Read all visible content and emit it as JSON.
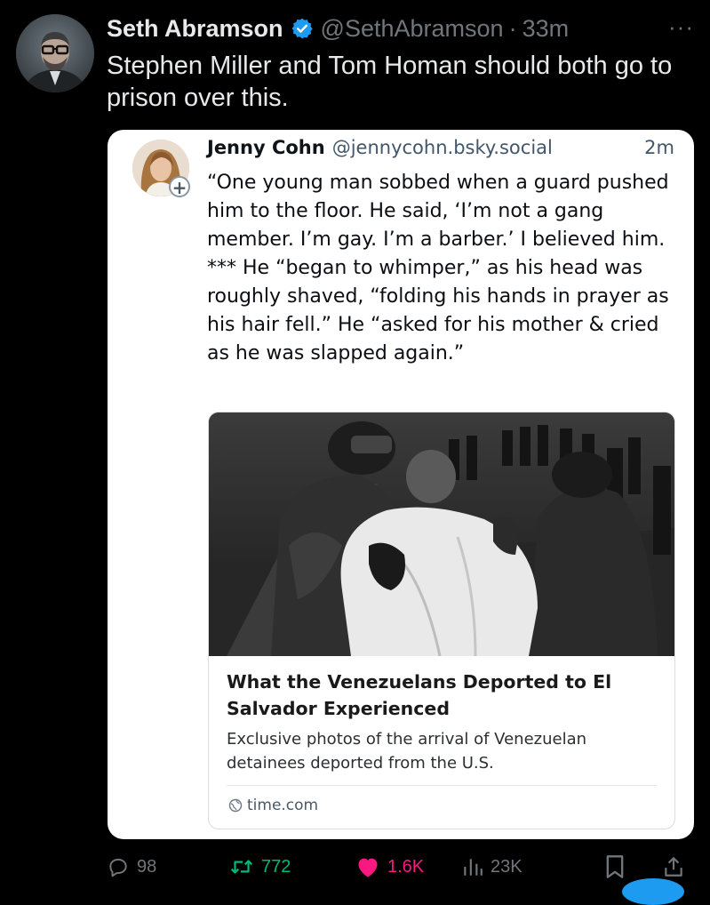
{
  "tweet": {
    "author_name": "Seth Abramson",
    "handle": "@SethAbramson",
    "separator": "·",
    "time": "33m",
    "more_label": "···",
    "text": "Stephen Miller and Tom Homan should both go to prison over this.",
    "verified_icon": "verified-badge-icon",
    "accent_color": "#1d9bf0"
  },
  "quote": {
    "author_name": "Jenny Cohn",
    "handle": "@jennycohn.bsky.social",
    "time": "2m",
    "follow_badge": "+",
    "text": "“One young man sobbed when a guard pushed him to the floor. He said, ‘I’m not a gang member. I’m gay. I’m a barber.’ I believed him. *** He “began to whimper,” as his head was roughly shaved, “folding his hands in prayer as his hair fell.” He “asked for his mother & cried as he was slapped again.”",
    "link_card": {
      "title": "What the Venezuelans Deported to El Salvador Experienced",
      "description": "Exclusive photos of the arrival of Venezuelan detainees deported from the U.S.",
      "domain": "time.com",
      "domain_icon": "globe-icon"
    }
  },
  "actions": {
    "replies": "98",
    "retweets": "772",
    "likes": "1.6K",
    "views": "23K",
    "reply_icon": "reply-icon",
    "retweet_icon": "retweet-icon",
    "like_icon": "heart-icon",
    "views_icon": "views-icon",
    "bookmark_icon": "bookmark-icon",
    "share_icon": "share-icon",
    "retweet_color": "#00ba7c",
    "like_color": "#f91880",
    "muted_color": "#71767b"
  }
}
